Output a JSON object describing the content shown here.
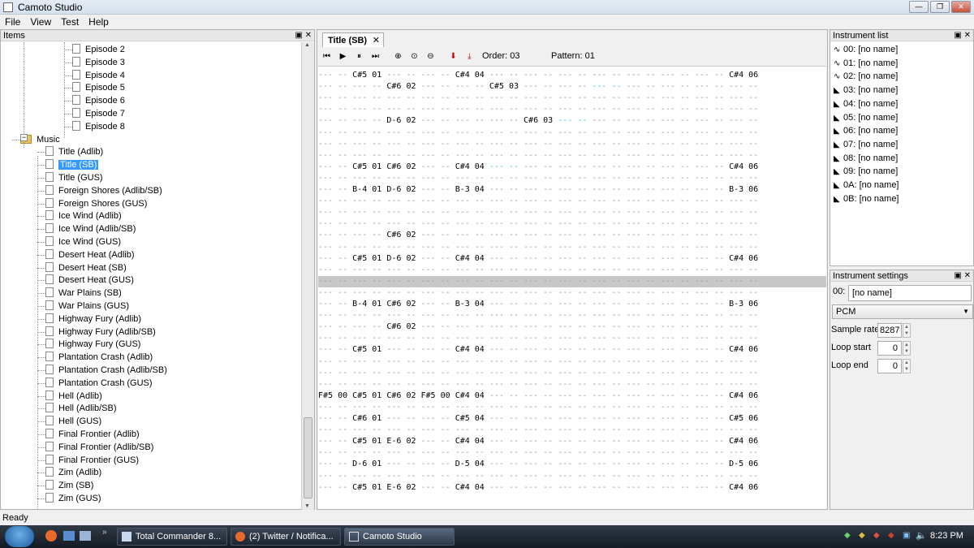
{
  "window": {
    "title": "Camoto Studio",
    "min": "—",
    "max": "❐",
    "close": "✕"
  },
  "menu": [
    "File",
    "View",
    "Test",
    "Help"
  ],
  "items_panel": {
    "title": "Items"
  },
  "tree": [
    {
      "label": "Episode 2",
      "type": "doc",
      "depth": 2
    },
    {
      "label": "Episode 3",
      "type": "doc",
      "depth": 2
    },
    {
      "label": "Episode 4",
      "type": "doc",
      "depth": 2
    },
    {
      "label": "Episode 5",
      "type": "doc",
      "depth": 2
    },
    {
      "label": "Episode 6",
      "type": "doc",
      "depth": 2
    },
    {
      "label": "Episode 7",
      "type": "doc",
      "depth": 2
    },
    {
      "label": "Episode 8",
      "type": "doc",
      "depth": 2
    },
    {
      "label": "Music",
      "type": "folder",
      "depth": 1
    },
    {
      "label": "Title (Adlib)",
      "type": "doc",
      "depth": 2
    },
    {
      "label": "Title (SB)",
      "type": "doc",
      "depth": 2,
      "selected": true
    },
    {
      "label": "Title (GUS)",
      "type": "doc",
      "depth": 2
    },
    {
      "label": "Foreign Shores (Adlib/SB)",
      "type": "doc",
      "depth": 2
    },
    {
      "label": "Foreign Shores (GUS)",
      "type": "doc",
      "depth": 2
    },
    {
      "label": "Ice Wind (Adlib)",
      "type": "doc",
      "depth": 2
    },
    {
      "label": "Ice Wind (Adlib/SB)",
      "type": "doc",
      "depth": 2
    },
    {
      "label": "Ice Wind (GUS)",
      "type": "doc",
      "depth": 2
    },
    {
      "label": "Desert Heat (Adlib)",
      "type": "doc",
      "depth": 2
    },
    {
      "label": "Desert Heat (SB)",
      "type": "doc",
      "depth": 2
    },
    {
      "label": "Desert Heat (GUS)",
      "type": "doc",
      "depth": 2
    },
    {
      "label": "War Plains (SB)",
      "type": "doc",
      "depth": 2
    },
    {
      "label": "War Plains (GUS)",
      "type": "doc",
      "depth": 2
    },
    {
      "label": "Highway Fury (Adlib)",
      "type": "doc",
      "depth": 2
    },
    {
      "label": "Highway Fury (Adlib/SB)",
      "type": "doc",
      "depth": 2
    },
    {
      "label": "Highway Fury (GUS)",
      "type": "doc",
      "depth": 2
    },
    {
      "label": "Plantation Crash (Adlib)",
      "type": "doc",
      "depth": 2
    },
    {
      "label": "Plantation Crash (Adlib/SB)",
      "type": "doc",
      "depth": 2
    },
    {
      "label": "Plantation Crash (GUS)",
      "type": "doc",
      "depth": 2
    },
    {
      "label": "Hell (Adlib)",
      "type": "doc",
      "depth": 2
    },
    {
      "label": "Hell (Adlib/SB)",
      "type": "doc",
      "depth": 2
    },
    {
      "label": "Hell (GUS)",
      "type": "doc",
      "depth": 2
    },
    {
      "label": "Final Frontier (Adlib)",
      "type": "doc",
      "depth": 2
    },
    {
      "label": "Final Frontier (Adlib/SB)",
      "type": "doc",
      "depth": 2
    },
    {
      "label": "Final Frontier (GUS)",
      "type": "doc",
      "depth": 2
    },
    {
      "label": "Zim (Adlib)",
      "type": "doc",
      "depth": 2
    },
    {
      "label": "Zim (SB)",
      "type": "doc",
      "depth": 2
    },
    {
      "label": "Zim (GUS)",
      "type": "doc",
      "depth": 2
    }
  ],
  "editor": {
    "tab_label": "Title (SB)",
    "order_label": "Order: 03",
    "pattern_label": "Pattern: 01"
  },
  "pattern_rows": [
    "--- -- C#5 01 --- -- --- -- C#4 04 --- -- --- -- --- -- --- -- --- -- --- -- --- -- C#4 06",
    "--- -- --- -- C#6 02 --- -- --- -- C#5 03 --- -- --- -- ~~~ ~~ --- -- --- -- --- -- --- --",
    "--- -- --- -- --- -- --- -- --- -- --- -- --- -- --- -- --- -- --- -- --- -- --- -- --- --",
    "--- -- --- -- --- -- --- -- --- -- --- -- --- -- --- -- --- -- --- -- --- -- --- -- --- --",
    "--- -- --- -- D-6 02 --- -- --- -- --- -- C#6 03 ~~~ ~~ --- -- --- -- --- -- --- -- --- --",
    "--- -- --- -- --- -- --- -- --- -- --- -- --- -- --- -- --- -- --- -- --- -- --- -- --- --",
    "--- -- --- -- --- -- --- -- --- -- --- -- --- -- --- -- --- -- --- -- --- -- --- -- --- --",
    "--- -- --- -- --- -- --- -- --- -- --- -- --- -- --- -- --- -- --- -- --- -- --- -- --- --",
    "--- -- C#5 01 C#6 02 --- -- C#4 04 ~~~ ~~ --- -- --- -- --- -- --- -- --- -- --- -- C#4 06",
    "--- -- --- -- --- -- --- -- --- -- --- -- --- -- --- -- --- -- --- -- --- -- --- -- --- --",
    "--- -- B-4 01 D-6 02 --- -- B-3 04 --- -- --- -- --- -- --- -- --- -- --- -- --- -- B-3 06",
    "--- -- --- -- --- -- --- -- --- -- --- -- --- -- --- -- --- -- --- -- --- -- --- -- --- --",
    "--- -- --- -- --- -- --- -- --- -- --- -- --- -- --- -- --- -- --- -- --- -- --- -- --- --",
    "--- -- --- -- --- -- --- -- --- -- --- -- --- -- --- -- --- -- --- -- --- -- --- -- --- --",
    "--- -- --- -- C#6 02 --- -- --- -- --- -- --- -- --- -- --- -- --- -- --- -- --- -- --- --",
    "--- -- --- -- --- -- --- -- --- -- --- -- --- -- --- -- --- -- --- -- --- -- --- -- --- --",
    "--- -- C#5 01 D-6 02 --- -- C#4 04 --- -- --- -- --- -- --- -- --- -- --- -- --- -- C#4 06",
    "--- -- --- -- --- -- --- -- --- -- --- -- --- -- --- -- --- -- --- -- --- -- --- -- --- --",
    "--- -- --- -- --- -- --- -- --- -- --- -- --- -- --- -- --- -- --- -- --- -- --- -- --- --",
    "--- -- --- -- --- -- --- -- --- -- --- -- --- -- --- -- --- -- --- -- --- -- --- -- --- --",
    "--- -- B-4 01 C#6 02 --- -- B-3 04 --- -- --- -- --- -- --- -- --- -- --- -- --- -- B-3 06",
    "--- -- --- -- --- -- --- -- --- -- --- -- --- -- --- -- --- -- --- -- --- -- --- -- --- --",
    "--- -- --- -- C#6 02 --- -- --- -- --- -- --- -- --- -- --- -- --- -- --- -- --- -- --- --",
    "--- -- --- -- --- -- --- -- --- -- --- -- --- -- --- -- --- -- --- -- --- -- --- -- --- --",
    "--- -- C#5 01 --- -- --- -- C#4 04 --- -- --- -- --- -- --- -- --- -- --- -- --- -- C#4 06",
    "--- -- --- -- --- -- --- -- --- -- --- -- --- -- --- -- --- -- --- -- --- -- --- -- --- --",
    "--- -- --- -- --- -- --- -- --- -- --- -- --- -- --- -- --- -- --- -- --- -- --- -- --- --",
    "--- -- --- -- --- -- --- -- --- -- --- -- --- -- --- -- --- -- --- -- --- -- --- -- --- --",
    "F#5 00 C#5 01 C#6 02 F#5 00 C#4 04 --- -- --- -- --- -- --- -- --- -- --- -- --- -- C#4 06",
    "--- -- --- -- --- -- --- -- --- -- --- -- --- -- --- -- --- -- --- -- --- -- --- -- --- --",
    "--- -- C#6 01 --- -- --- -- C#5 04 --- -- --- -- --- -- --- -- --- -- --- -- --- -- C#5 06",
    "--- -- --- -- --- -- --- -- --- -- --- -- --- -- --- -- --- -- --- -- --- -- --- -- --- --",
    "--- -- C#5 01 E-6 02 --- -- C#4 04 --- -- --- -- --- -- --- -- --- -- --- -- --- -- C#4 06",
    "--- -- --- -- --- -- --- -- --- -- --- -- --- -- --- -- --- -- --- -- --- -- --- -- --- --",
    "--- -- D-6 01 --- -- --- -- D-5 04 --- -- --- -- --- -- --- -- --- -- --- -- --- -- D-5 06",
    "--- -- --- -- --- -- --- -- --- -- --- -- --- -- --- -- --- -- --- -- --- -- --- -- --- --",
    "--- -- C#5 01 E-6 02 --- -- C#4 04 --- -- --- -- --- -- --- -- --- -- --- -- --- -- C#4 06"
  ],
  "highlight_row": 18,
  "instrument_list": {
    "title": "Instrument list",
    "items": [
      {
        "label": "00: [no name]",
        "kind": "wave"
      },
      {
        "label": "01: [no name]",
        "kind": "wave"
      },
      {
        "label": "02: [no name]",
        "kind": "wave"
      },
      {
        "label": "03: [no name]",
        "kind": "pcm"
      },
      {
        "label": "04: [no name]",
        "kind": "pcm"
      },
      {
        "label": "05: [no name]",
        "kind": "pcm"
      },
      {
        "label": "06: [no name]",
        "kind": "pcm"
      },
      {
        "label": "07: [no name]",
        "kind": "pcm"
      },
      {
        "label": "08: [no name]",
        "kind": "pcm"
      },
      {
        "label": "09: [no name]",
        "kind": "pcm"
      },
      {
        "label": "0A: [no name]",
        "kind": "pcm"
      },
      {
        "label": "0B: [no name]",
        "kind": "pcm"
      }
    ]
  },
  "instrument_settings": {
    "title": "Instrument settings",
    "index": "00:",
    "name": "[no name]",
    "type": "PCM",
    "sample_rate_label": "Sample rate",
    "sample_rate": "8287",
    "loop_start_label": "Loop start",
    "loop_start": "0",
    "loop_end_label": "Loop end",
    "loop_end": "0"
  },
  "status": "Ready",
  "taskbar": {
    "tasks": [
      "Total Commander 8...",
      "(2) Twitter / Notifica...",
      "Camoto Studio"
    ],
    "clock": "8:23 PM"
  }
}
